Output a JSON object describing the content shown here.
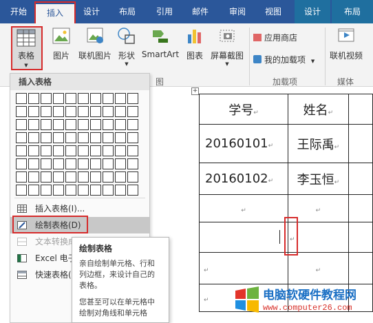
{
  "tabs": [
    {
      "label": "开始"
    },
    {
      "label": "插入",
      "active": true
    },
    {
      "label": "设计"
    },
    {
      "label": "布局"
    },
    {
      "label": "引用"
    },
    {
      "label": "邮件"
    },
    {
      "label": "审阅"
    },
    {
      "label": "视图"
    },
    {
      "label": "设计",
      "contextual": true
    },
    {
      "label": "布局",
      "contextual": true
    }
  ],
  "ribbon": {
    "table_button": "表格",
    "picture": "图片",
    "online_picture": "联机图片",
    "shapes": "形状",
    "smartart": "SmartArt",
    "chart": "图表",
    "screenshot": "屏幕截图",
    "group_illustrations": "图",
    "app_store": "应用商店",
    "my_addins": "我的加载项",
    "group_addins": "加载项",
    "online_video": "联机视频",
    "group_media": "媒体"
  },
  "dropdown": {
    "header": "插入表格",
    "items": [
      {
        "label": "插入表格(I)...",
        "icon": "insert-table-icon"
      },
      {
        "label": "绘制表格(D)",
        "icon": "draw-table-icon",
        "highlighted": true
      },
      {
        "label": "文本转换成",
        "icon": "text-to-table-icon",
        "disabled": true
      },
      {
        "label": "Excel 电子",
        "icon": "excel-icon"
      },
      {
        "label": "快速表格(",
        "icon": "quick-table-icon"
      }
    ]
  },
  "tooltip": {
    "title": "绘制表格",
    "line1": "亲自绘制单元格、行和列边框，来设计自己的表格。",
    "line2": "您甚至可以在单元格中绘制对角线和单元格"
  },
  "document": {
    "rows": [
      [
        "学号",
        "姓名"
      ],
      [
        "20160101",
        "王际禹"
      ],
      [
        "20160102",
        "李玉恒"
      ],
      [
        "",
        ""
      ],
      [
        "",
        ""
      ],
      [
        "",
        ""
      ],
      [
        "",
        ""
      ]
    ]
  },
  "watermark": {
    "brand": "电脑软硬件教程网",
    "url": "www.computer26.com"
  },
  "colors": {
    "ribbon_blue": "#2b579a",
    "highlight_red": "#d62a2a"
  }
}
